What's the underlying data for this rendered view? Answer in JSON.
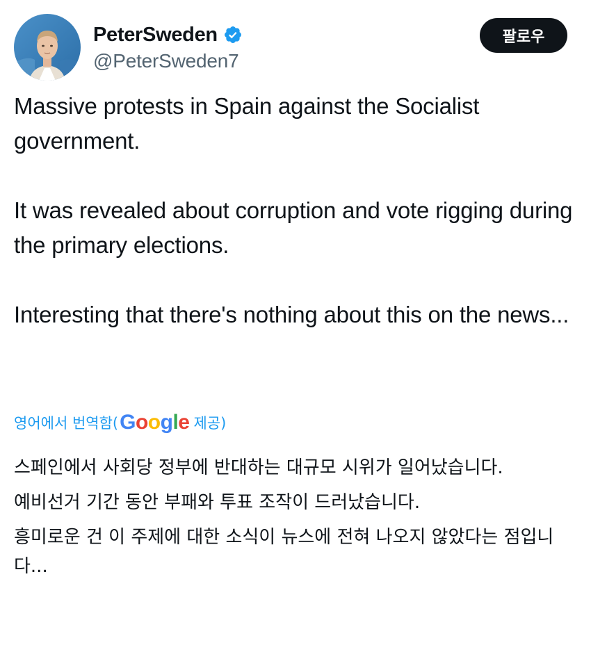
{
  "user": {
    "display_name": "PeterSweden",
    "handle": "@PeterSweden7",
    "verified": true,
    "avatar_icon": "profile-photo",
    "verified_icon": "verified-badge-icon",
    "verified_color": "#1d9bf0"
  },
  "follow_button": {
    "label": "팔로우"
  },
  "tweet": {
    "paragraphs": [
      "Massive protests in Spain against the Socialist government.",
      "It was revealed about corruption and vote rigging during the primary elections.",
      "Interesting that there's nothing about this on the news..."
    ]
  },
  "translation": {
    "prefix": "영어에서 번역함(",
    "provider": "Google",
    "suffix": " 제공)",
    "link_color": "#1d9bf0",
    "paragraphs": [
      "스페인에서 사회당 정부에 반대하는 대규모 시위가 일어났습니다.",
      "예비선거 기간 동안 부패와 투표 조작이 드러났습니다.",
      "흥미로운 건 이 주제에 대한 소식이 뉴스에 전혀 나오지 않았다는 점입니다..."
    ]
  }
}
